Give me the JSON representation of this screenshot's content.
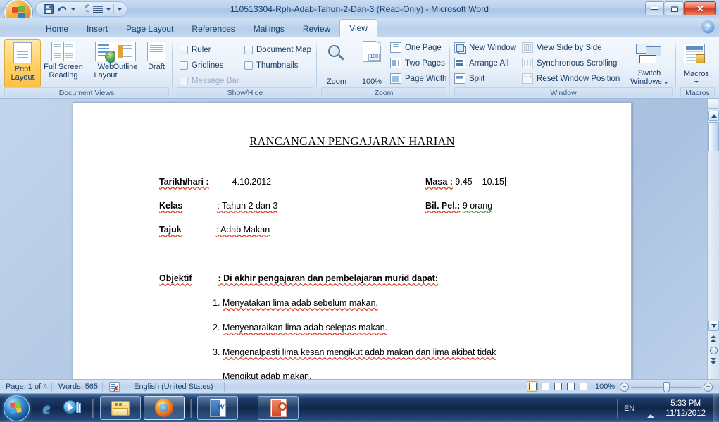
{
  "window": {
    "title": "110513304-Rph-Adab-Tahun-2-Dan-3 (Read-Only) - Microsoft Word",
    "office_button": "office-orb",
    "quick_access": [
      {
        "name": "save",
        "icon": "save-icon"
      },
      {
        "name": "undo",
        "icon": "undo-icon"
      },
      {
        "name": "redo",
        "icon": "redo-icon"
      },
      {
        "name": "styles",
        "icon": "lines-icon"
      }
    ],
    "controls": {
      "minimize": "minimize-icon",
      "maximize": "maximize-icon",
      "close": "close-icon"
    }
  },
  "ribbon": {
    "tabs": [
      {
        "label": "Home",
        "active": false
      },
      {
        "label": "Insert",
        "active": false
      },
      {
        "label": "Page Layout",
        "active": false
      },
      {
        "label": "References",
        "active": false
      },
      {
        "label": "Mailings",
        "active": false
      },
      {
        "label": "Review",
        "active": false
      },
      {
        "label": "View",
        "active": true
      }
    ],
    "help_label": "?",
    "groups": [
      {
        "name": "Document Views",
        "label": "Document Views",
        "buttons": [
          {
            "label1": "Print",
            "label2": "Layout",
            "selected": true
          },
          {
            "label1": "Full Screen",
            "label2": "Reading",
            "selected": false
          },
          {
            "label1": "Web",
            "label2": "Layout",
            "selected": false
          },
          {
            "label1": "Outline",
            "label2": "",
            "selected": false
          },
          {
            "label1": "Draft",
            "label2": "",
            "selected": false
          }
        ]
      },
      {
        "name": "Show/Hide",
        "label": "Show/Hide",
        "checkboxes": [
          {
            "label": "Ruler",
            "checked": false,
            "disabled": false
          },
          {
            "label": "Gridlines",
            "checked": false,
            "disabled": false
          },
          {
            "label": "Message Bar",
            "checked": false,
            "disabled": true
          },
          {
            "label": "Document Map",
            "checked": false,
            "disabled": false
          },
          {
            "label": "Thumbnails",
            "checked": false,
            "disabled": false
          }
        ]
      },
      {
        "name": "Zoom",
        "label": "Zoom",
        "big": [
          {
            "label": "Zoom"
          },
          {
            "label": "100%"
          }
        ],
        "items": [
          {
            "label": "One Page"
          },
          {
            "label": "Two Pages"
          },
          {
            "label": "Page Width"
          }
        ]
      },
      {
        "name": "Window",
        "label": "Window",
        "items": [
          {
            "label": "New Window",
            "disabled": false
          },
          {
            "label": "Arrange All",
            "disabled": false
          },
          {
            "label": "Split",
            "disabled": false
          },
          {
            "label": "View Side by Side",
            "disabled": true
          },
          {
            "label": "Synchronous Scrolling",
            "disabled": true
          },
          {
            "label": "Reset Window Position",
            "disabled": true
          }
        ],
        "switch_windows": {
          "label1": "Switch",
          "label2": "Windows"
        }
      },
      {
        "name": "Macros",
        "label": "Macros",
        "button": {
          "label": "Macros"
        }
      }
    ]
  },
  "document": {
    "title": "RANCANGAN PENGAJARAN HARIAN",
    "fields": [
      {
        "label": "Tarikh/hari :",
        "value": "4.10.2012"
      },
      {
        "label": "Kelas",
        "value": ": Tahun 2 dan 3"
      },
      {
        "label": "Tajuk",
        "value": ": Adab Makan"
      }
    ],
    "fields_right": [
      {
        "label": "Masa :",
        "value": "9.45 – 10.15"
      },
      {
        "label": "Bil. Pel.:",
        "value": "9 orang"
      }
    ],
    "objektif": {
      "label": "Objektif",
      "intro": ": Di akhir pengajaran dan pembelajaran murid dapat:",
      "items": [
        {
          "num": "1.",
          "text": "Menyatakan  lima adab sebelum makan."
        },
        {
          "num": "2.",
          "text": "Menyenaraikan  lima adab selepas makan."
        },
        {
          "num": "3.",
          "text": "Mengenalpasti  lima kesan mengikut adab makan dan lima  akibat tidak"
        },
        {
          "num": "",
          "text": "Mengikut adab makan."
        }
      ]
    }
  },
  "statusbar": {
    "page": "Page: 1 of 4",
    "words": "Words: 565",
    "proofing_icon": "spelling-check-icon",
    "language": "English (United States)",
    "zoom_level": "100%",
    "zoom_out": "−",
    "zoom_in": "+",
    "view_buttons": [
      {
        "name": "print-layout-view",
        "selected": true
      },
      {
        "name": "full-screen-reading-view",
        "selected": false
      },
      {
        "name": "web-layout-view",
        "selected": false
      },
      {
        "name": "outline-view",
        "selected": false
      },
      {
        "name": "draft-view",
        "selected": false
      }
    ]
  },
  "scrollbar": {
    "up_arrow": "scroll-up-icon",
    "down_arrow": "scroll-down-icon",
    "previous_page": "previous-page-icon",
    "select_browse_object": "select-browse-object-icon",
    "next_page": "next-page-icon"
  },
  "taskbar": {
    "start": "windows-start-orb",
    "quick_launch": [
      {
        "name": "internet-explorer",
        "icon": "internet-explorer-icon"
      },
      {
        "name": "windows-media-player",
        "icon": "windows-media-player-icon"
      }
    ],
    "tasks": [
      {
        "name": "windows-explorer",
        "icon": "folder-icon",
        "active": false
      },
      {
        "name": "mozilla-firefox",
        "icon": "firefox-icon",
        "active": true
      },
      {
        "name": "microsoft-word",
        "icon": "word-icon",
        "active": false
      },
      {
        "name": "microsoft-powerpoint",
        "icon": "powerpoint-icon",
        "active": false
      }
    ],
    "tray": {
      "language": "EN",
      "show_hidden": "show-hidden-icons-icon",
      "time": "5:33 PM",
      "date": "11/12/2012"
    }
  },
  "colors": {
    "accent": "#1b3c63",
    "selected": "#ffd063",
    "close_button": "#cf3a1e",
    "spell_error": "#e03b24",
    "grammar_error": "#2e8b2e"
  }
}
